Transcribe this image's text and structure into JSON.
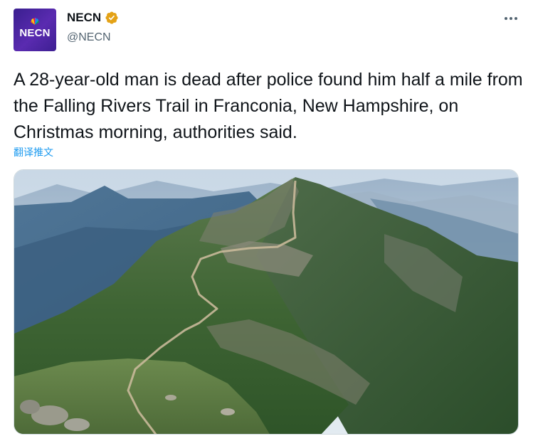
{
  "author": {
    "display_name": "NECN",
    "handle": "@NECN",
    "avatar_label": "NECN",
    "verified": true,
    "verified_color": "#e4a216"
  },
  "tweet": {
    "text": "A 28-year-old man is dead after police found him half a mile from the Falling Rivers Trail in Franconia, New Hampshire, on Christmas morning, authorities said.",
    "translate_label": "翻译推文"
  },
  "icons": {
    "more": "more-horizontal-icon",
    "verified": "verified-badge-icon"
  },
  "colors": {
    "text_primary": "#0f1419",
    "text_secondary": "#536471",
    "link": "#1d9bf0",
    "avatar_bg": "#4b27a3"
  }
}
